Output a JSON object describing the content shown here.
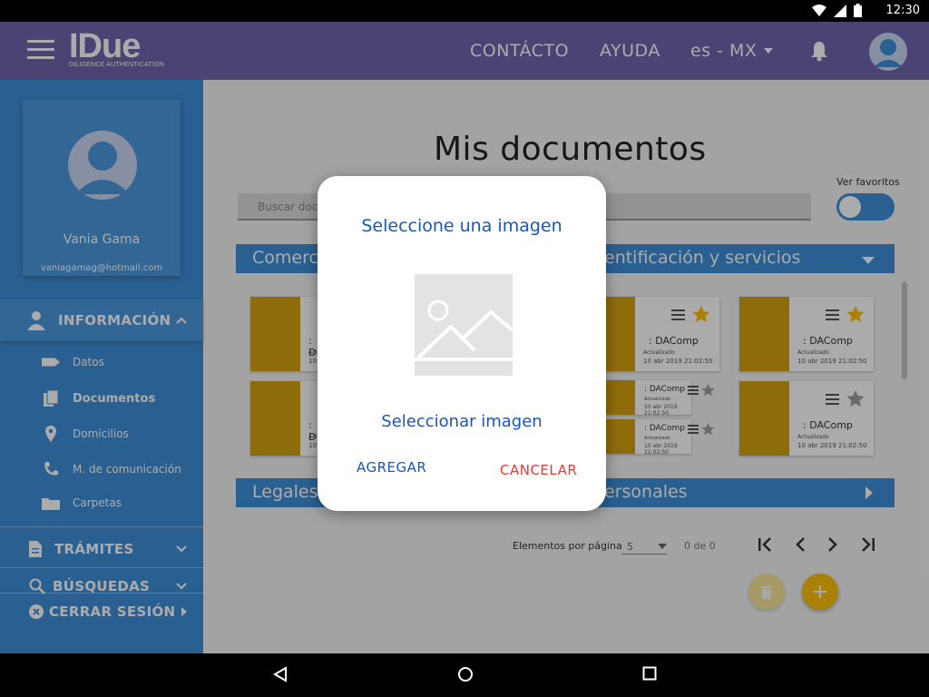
{
  "status_bar": {
    "time": "12:30"
  },
  "app_bar": {
    "brand": "IDue",
    "brand_tagline": "DILIGENCE AUTHENTICATION",
    "nav_contacto": "CONTÁCTO",
    "nav_ayuda": "AYUDA",
    "language": "es - MX"
  },
  "sidebar": {
    "profile_name": "Vania Gama",
    "profile_email": "vaniagamag@hotmail.com",
    "section_informacion": "INFORMACIÓN",
    "items": [
      {
        "label": "Datos"
      },
      {
        "label": "Documentos"
      },
      {
        "label": "Domicilios"
      },
      {
        "label": "M. de comunicación"
      },
      {
        "label": "Carpetas"
      }
    ],
    "section_tramites": "TRÁMITES",
    "section_busquedas": "BÚSQUEDAS",
    "logout": "CERRAR SESIÓN"
  },
  "main": {
    "title": "Mis documentos",
    "favorites_label": "Ver favoritos",
    "search_placeholder": "Buscar doc",
    "section1_left": "Comerc",
    "section1_right": "entificación y servicios",
    "section2_left": "Legales",
    "section2_right": "ersonales",
    "cards": [
      {
        "title": ": DAComp",
        "updated_label": "Actualizado",
        "date": "10 abr 2019 21:02:50"
      },
      {
        "title": ": DAComp",
        "updated_label": "Actualizado",
        "date": "10 abr 2019 21:02:50"
      },
      {
        "title": ": DAComp",
        "updated_label": "Actualizado",
        "date": "10 abr 2019 21:02:50"
      }
    ],
    "mini_cards": [
      {
        "title": ": DAComp",
        "updated_label": "Actualizado",
        "date": "10 abr 2019 21:02:50"
      },
      {
        "title": ": DAComp",
        "updated_label": "Actualizado",
        "date": "10 abr 2019 21:02:50"
      }
    ],
    "partial_cards": [
      {
        "title": ": D",
        "updated_label": "Actu",
        "date": "10"
      },
      {
        "title": ": D",
        "updated_label": "Actu",
        "date": "10"
      }
    ],
    "pager": {
      "label": "Elementos por página",
      "page_size": "5",
      "count": "0 de 0"
    }
  },
  "dialog": {
    "title": "Seleccione una imagen",
    "select_link": "Seleccionar imagen",
    "add_button": "AGREGAR",
    "cancel_button": "CANCELAR"
  },
  "colors": {
    "primary": "#3f8fd8",
    "appbar": "#6f64ac",
    "accent": "#ffc107",
    "dialog_title": "#1a56b6",
    "cancel": "#e53935"
  }
}
